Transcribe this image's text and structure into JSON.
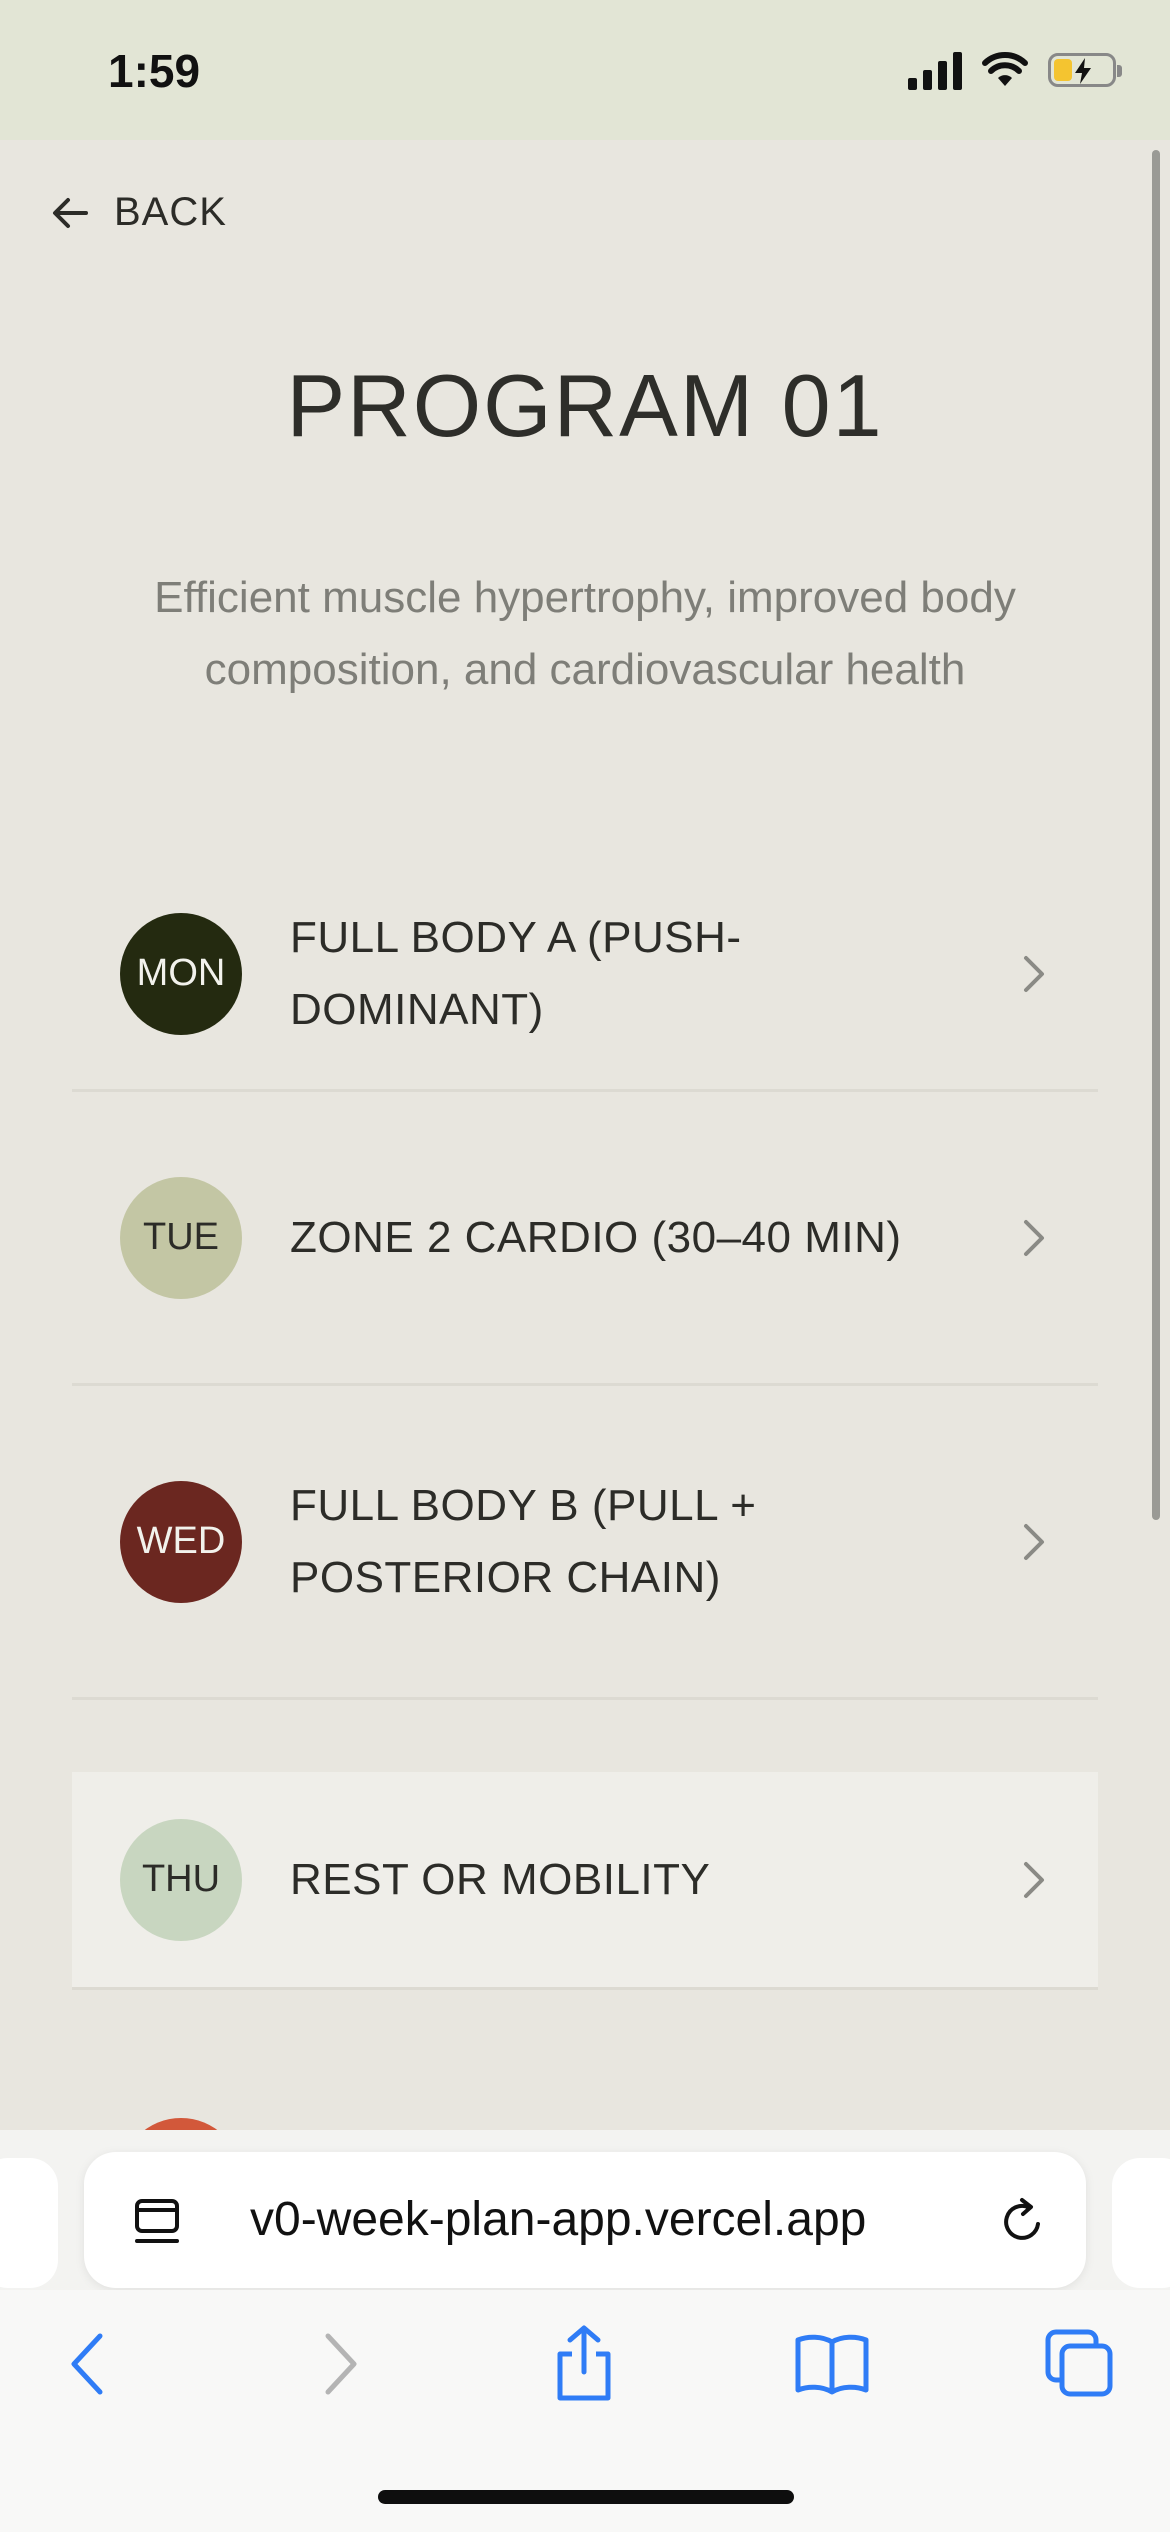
{
  "status_bar": {
    "time": "1:59"
  },
  "nav": {
    "back_label": "BACK"
  },
  "program": {
    "title": "PROGRAM 01",
    "subtitle": "Efficient muscle hypertrophy, improved body composition, and cardiovascular health"
  },
  "days": [
    {
      "day": "MON",
      "title": "FULL BODY A (PUSH-DOMINANT)",
      "color": "#242A10",
      "text_color": "#F2F2EC"
    },
    {
      "day": "TUE",
      "title": "ZONE 2 CARDIO (30–40 MIN)",
      "color": "#C3C6A4",
      "text_color": "#2C2C28"
    },
    {
      "day": "WED",
      "title": "FULL BODY B (PULL + POSTERIOR CHAIN)",
      "color": "#6B2720",
      "text_color": "#F2F2EC"
    },
    {
      "day": "THU",
      "title": "REST OR MOBILITY",
      "color": "#C8D6C0",
      "text_color": "#2C2C28"
    }
  ],
  "browser": {
    "url": "v0-week-plan-app.vercel.app"
  },
  "colors": {
    "background": "#E8E6DF",
    "accent_blue": "#2F7CF6"
  }
}
